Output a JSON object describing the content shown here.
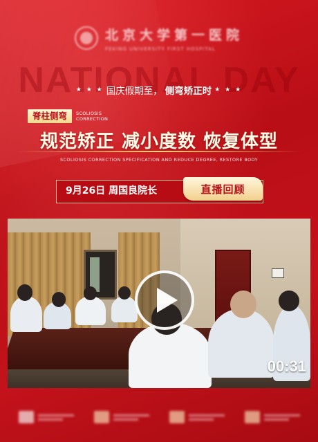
{
  "header": {
    "logo_name": "北京大学第一医院",
    "logo_subtitle": "PEKING UNIVERSITY FIRST HOSPITAL",
    "watermark": "NATIONAL DAY"
  },
  "holiday": {
    "stars_left": "★ ★ ★",
    "text_plain": "国庆假期至，",
    "text_emph": "侧弯矫正时",
    "stars_right": "★ ★ ★"
  },
  "tag": {
    "cn": "脊柱侧弯",
    "en_line1": "SCOLIOSIS",
    "en_line2": "CORRECTION"
  },
  "headline": "规范矫正 减小度数 恢复体型",
  "subline": "SCOLIOSIS CORRECTION SPECIFICATION AND REDUCE DEGREE, RESTORE BODY",
  "live": {
    "date_speaker": "9月26日 周国良院长",
    "button": "直播回顾"
  },
  "video": {
    "duration": "00:31"
  },
  "colors": {
    "background": "#c8121a",
    "gold": "#f2d08c",
    "accent_red": "#b5121a"
  }
}
